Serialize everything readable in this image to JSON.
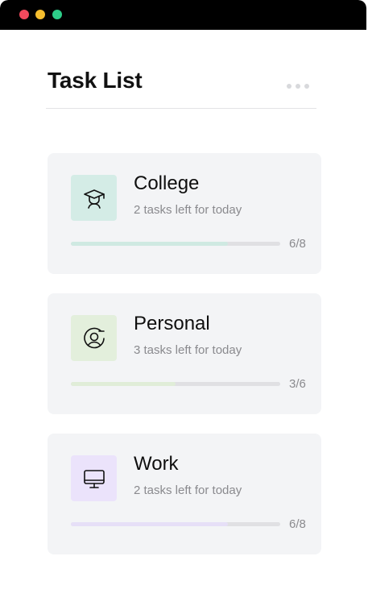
{
  "window": {
    "controls": {
      "close_color": "#f2495d",
      "minimize_color": "#f5be2e",
      "maximize_color": "#2dce89"
    }
  },
  "header": {
    "title": "Task List",
    "menu_icon": "more-horizontal-icon"
  },
  "cards": [
    {
      "title": "College",
      "subtitle": "2 tasks left for today",
      "progress_text": "6/8",
      "progress": 0.75,
      "icon": "graduation-cap-icon",
      "icon_bg": "#d4ece6",
      "bar_color": "#cfe9e2"
    },
    {
      "title": "Personal",
      "subtitle": "3 tasks left for today",
      "progress_text": "3/6",
      "progress": 0.5,
      "icon": "user-circle-icon",
      "icon_bg": "#e3efdc",
      "bar_color": "#e0edd8"
    },
    {
      "title": "Work",
      "subtitle": "2 tasks left for today",
      "progress_text": "6/8",
      "progress": 0.75,
      "icon": "monitor-icon",
      "icon_bg": "#ebe3fb",
      "bar_color": "#e6dff7"
    }
  ]
}
